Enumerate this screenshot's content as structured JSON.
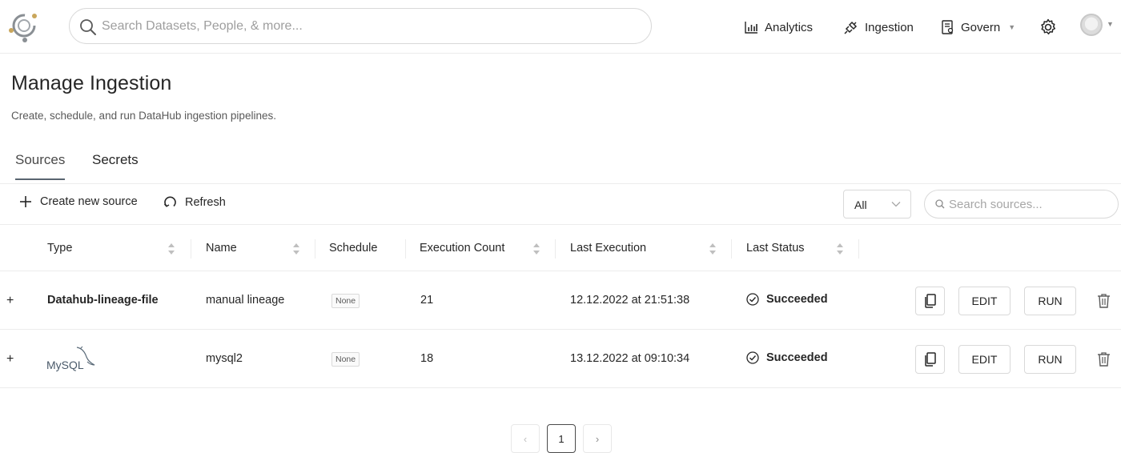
{
  "header": {
    "search_placeholder": "Search Datasets, People, & more...",
    "nav": {
      "analytics": "Analytics",
      "ingestion": "Ingestion",
      "govern": "Govern"
    }
  },
  "page": {
    "title": "Manage Ingestion",
    "subtitle": "Create, schedule, and run DataHub ingestion pipelines."
  },
  "tabs": {
    "sources": "Sources",
    "secrets": "Secrets"
  },
  "toolbar": {
    "create_label": "Create new source",
    "refresh_label": "Refresh",
    "filter_value": "All",
    "search_placeholder": "Search sources..."
  },
  "table": {
    "headers": {
      "type": "Type",
      "name": "Name",
      "schedule": "Schedule",
      "execution_count": "Execution Count",
      "last_execution": "Last Execution",
      "last_status": "Last Status"
    },
    "rows": [
      {
        "expand": "+",
        "type": "Datahub-lineage-file",
        "type_icon": null,
        "name": "manual lineage",
        "schedule": "None",
        "execution_count": "21",
        "last_execution": "12.12.2022 at 21:51:38",
        "last_status": "Succeeded",
        "edit_label": "EDIT",
        "run_label": "RUN"
      },
      {
        "expand": "+",
        "type": "MySQL",
        "type_icon": "mysql-logo",
        "name": "mysql2",
        "schedule": "None",
        "execution_count": "18",
        "last_execution": "13.12.2022 at 09:10:34",
        "last_status": "Succeeded",
        "edit_label": "EDIT",
        "run_label": "RUN"
      }
    ]
  },
  "pagination": {
    "current": "1",
    "prev": "‹",
    "next": "›"
  },
  "colors": {
    "border": "#d9d9d9",
    "divider": "#ececec",
    "tab_indicator": "#596570",
    "text": "#262626",
    "muted": "#9e9e9e"
  }
}
